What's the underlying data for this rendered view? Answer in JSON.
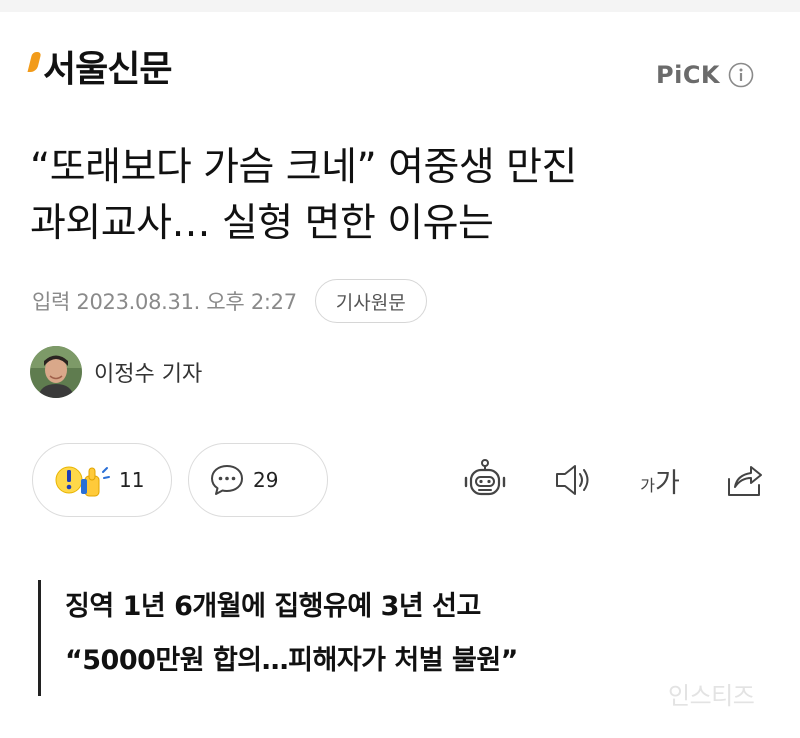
{
  "header": {
    "logo_text": "서울신문",
    "pick_label": "PiCK",
    "accent_color": "#f29b1a"
  },
  "article": {
    "headline_line1": "“또래보다 가슴 크네” 여중생 만진",
    "headline_line2": "과외교사… 실형 면한 이유는",
    "date": "입력 2023.08.31. 오후 2:27",
    "source_button_label": "기사원문",
    "author": "이정수 기자"
  },
  "actions": {
    "reaction_count": "11",
    "comment_count": "29",
    "font_size_small": "가",
    "font_size_large": "가"
  },
  "icons": {
    "info": "info-icon",
    "reaction": "reaction-icon",
    "comment": "comment-icon",
    "summary": "robot-icon",
    "tts": "speaker-icon",
    "share": "share-icon"
  },
  "subheadline": {
    "line1": "징역 1년 6개월에 집행유예 3년 선고",
    "line2": "“5000만원 합의…피해자가 처벌 불원”"
  },
  "watermark": "인스티즈"
}
